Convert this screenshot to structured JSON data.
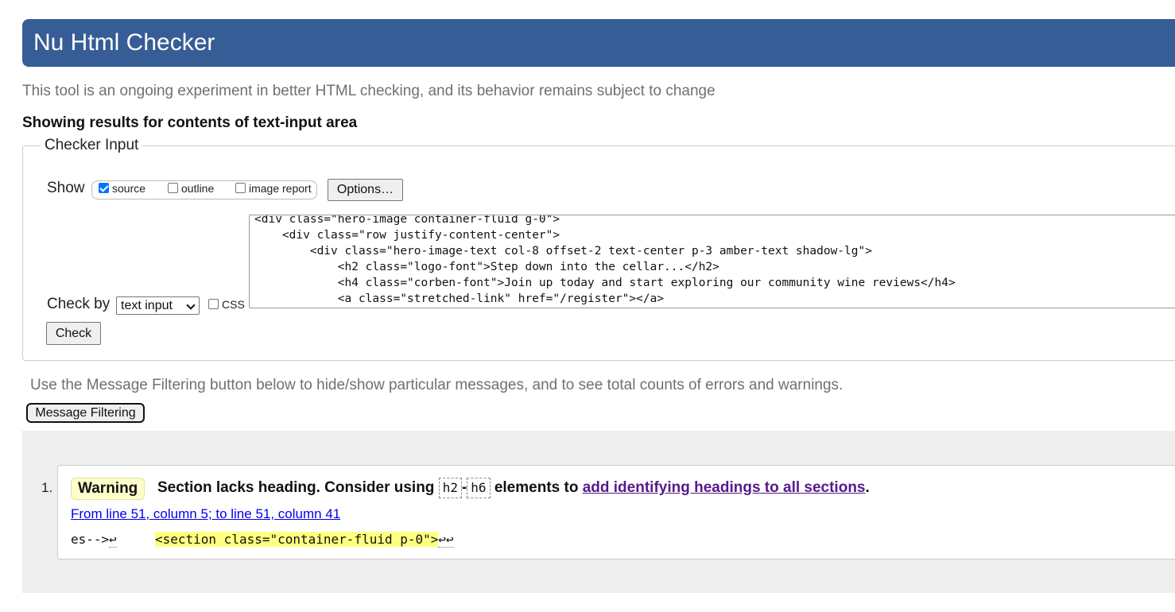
{
  "header": {
    "title": "Nu Html Checker"
  },
  "subtitle": "This tool is an ongoing experiment in better HTML checking, and its behavior remains subject to change",
  "results_heading": "Showing results for contents of text-input area",
  "checker_input": {
    "legend": "Checker Input",
    "show_label": "Show",
    "show_options": [
      {
        "label": "source",
        "checked": true
      },
      {
        "label": "outline",
        "checked": false
      },
      {
        "label": "image report",
        "checked": false
      }
    ],
    "options_button": "Options…",
    "source_lines": [
      "<div class=\"hero-image container-fluid g-0\">",
      "    <div class=\"row justify-content-center\">",
      "        <div class=\"hero-image-text col-8 offset-2 text-center p-3 amber-text shadow-lg\">",
      "            <h2 class=\"logo-font\">Step down into the cellar...</h2>",
      "            <h4 class=\"corben-font\">Join up today and start exploring our community wine reviews</h4>",
      "            <a class=\"stretched-link\" href=\"/register\"></a>"
    ],
    "check_by_label": "Check by",
    "check_by_value": "text input",
    "css_label": "CSS",
    "css_checked": false,
    "check_button": "Check"
  },
  "filter": {
    "note": "Use the Message Filtering button below to hide/show particular messages, and to see total counts of errors and warnings.",
    "button": "Message Filtering"
  },
  "messages": [
    {
      "number": "1.",
      "type": "Warning",
      "text_before": "Section lacks heading. Consider using ",
      "tag_from": "h2",
      "separator": "-",
      "tag_to": "h6",
      "text_middle": " elements to ",
      "link_text": "add identifying headings to all sections",
      "text_after": ".",
      "location": "From line 51, column 5; to line 51, column 41",
      "extract_before": "es-->",
      "return_symbol": "↩",
      "extract_gap": "     ",
      "extract_highlight": "<section class=\"container-fluid p-0\">",
      "extract_after": "↩↩"
    }
  ],
  "colors": {
    "header_bg": "#365d95",
    "warning_bg": "#ffffcc",
    "highlight_bg": "#ffff80",
    "results_bg": "#eeeeee",
    "visited_link": "#551a8b",
    "link": "#0000ee"
  }
}
